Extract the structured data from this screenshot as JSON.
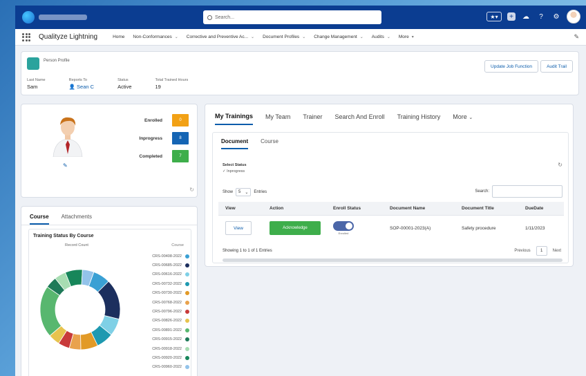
{
  "topbar": {
    "search_placeholder": "Search..."
  },
  "nav": {
    "app_name": "Qualityze Lightning",
    "items": [
      {
        "label": "Home",
        "has_menu": false
      },
      {
        "label": "Non-Conformances",
        "has_menu": true
      },
      {
        "label": "Corrective and Preventive Ac...",
        "has_menu": true
      },
      {
        "label": "Document Profiles",
        "has_menu": true
      },
      {
        "label": "Change Management",
        "has_menu": true
      },
      {
        "label": "Audits",
        "has_menu": true
      },
      {
        "label": "More",
        "has_menu": true
      }
    ]
  },
  "header": {
    "object_label": "Person Profile",
    "buttons": {
      "update_job": "Update Job Function",
      "audit_trail": "Audit Trail"
    },
    "fields": [
      {
        "label": "Last Name",
        "value": "Sam"
      },
      {
        "label": "Reports To",
        "value": "Sean C"
      },
      {
        "label": "Status",
        "value": "Active"
      },
      {
        "label": "Total Trained Hours",
        "value": "19"
      }
    ]
  },
  "profile": {
    "stats": [
      {
        "label": "Enrolled",
        "value": "0",
        "color": "#f2a115"
      },
      {
        "label": "Inprogress",
        "value": "8",
        "color": "#1565b4"
      },
      {
        "label": "Completed",
        "value": "7",
        "color": "#3eae4b"
      }
    ]
  },
  "course_panel": {
    "tabs": [
      "Course",
      "Attachments"
    ],
    "active_tab": "Course",
    "chart_title": "Training Status By Course",
    "chart_subtitle": "Record Count",
    "legend_title": "Course"
  },
  "chart_data": {
    "type": "pie",
    "title": "Training Status By Course",
    "subtitle": "Record Count",
    "legend_title": "Course",
    "donut": true,
    "categories": [
      "CRS-00408-2022",
      "CRS-00685-2022",
      "CRS-00616-2022",
      "CRS-00732-2022",
      "CRS-00730-2022",
      "CRS-00768-2022",
      "CRS-00796-2022",
      "CRS-00826-2022",
      "CRS-00891-2022",
      "CRS-00915-2022",
      "CRS-00918-2022",
      "CRS-00920-2022",
      "CRS-00960-2022"
    ],
    "values": [
      3,
      7,
      3,
      3,
      3,
      2,
      2,
      2,
      9,
      2,
      2,
      3,
      2
    ],
    "colors": [
      "#3aa0d4",
      "#1c2f5e",
      "#7fd0e6",
      "#1e99b0",
      "#e29a27",
      "#e9a24d",
      "#c83a3a",
      "#e7c34e",
      "#58b76f",
      "#1e7a58",
      "#a7ddb2",
      "#17865a",
      "#93c3ea"
    ]
  },
  "main": {
    "tabs": [
      "My Trainings",
      "My Team",
      "Trainer",
      "Search And Enroll",
      "Training History",
      "More"
    ],
    "active_tab": "My Trainings",
    "sub_tabs": [
      "Document",
      "Course"
    ],
    "active_sub_tab": "Document",
    "select_status_label": "Select Status",
    "select_status_value": "Inprogress",
    "show_label": "Show",
    "show_value": "5",
    "entries_label": "Entries",
    "search_label": "Search:",
    "columns": [
      "View",
      "Action",
      "Enroll Status",
      "Document Name",
      "Document Title",
      "DueDate"
    ],
    "rows": [
      {
        "view": "View",
        "action": "Acknowledge",
        "enroll_status": "Enrolled",
        "document_name": "SOP-00001-2023(A)",
        "document_title": "Safety procedure",
        "due_date": "1/11/2023"
      }
    ],
    "showing_text": "Showing 1 to 1 of 1 Entries",
    "pager": {
      "previous": "Previous",
      "page": "1",
      "next": "Next"
    }
  }
}
